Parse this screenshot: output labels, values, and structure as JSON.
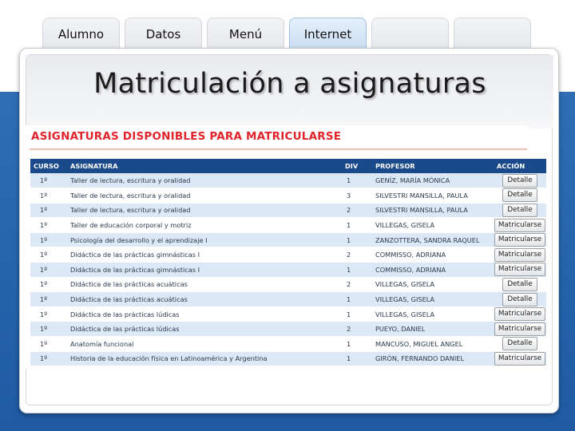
{
  "tabs": [
    {
      "label": "Alumno",
      "active": false
    },
    {
      "label": "Datos",
      "active": false
    },
    {
      "label": "Menú",
      "active": false
    },
    {
      "label": "Internet",
      "active": true
    },
    {
      "label": "",
      "active": false
    },
    {
      "label": "",
      "active": false
    }
  ],
  "page_title": "Matriculación a asignaturas",
  "section_title": "ASIGNATURAS DISPONIBLES PARA MATRICULARSE",
  "table": {
    "headers": {
      "curso": "CURSO",
      "asignatura": "ASIGNATURA",
      "div": "DIV",
      "profesor": "PROFESOR",
      "accion": "ACCIÓN"
    },
    "rows": [
      {
        "curso": "1º",
        "asignatura": "Taller de lectura, escritura y oralidad",
        "div": "1",
        "profesor": "GENÍZ, MARÍA MÓNICA",
        "accion": "Detalle"
      },
      {
        "curso": "1º",
        "asignatura": "Taller de lectura, escritura y oralidad",
        "div": "3",
        "profesor": "SILVESTRI MANSILLA, PAULA",
        "accion": "Detalle"
      },
      {
        "curso": "1º",
        "asignatura": "Taller de lectura, escritura y oralidad",
        "div": "2",
        "profesor": "SILVESTRI MANSILLA, PAULA",
        "accion": "Detalle"
      },
      {
        "curso": "1º",
        "asignatura": "Taller de educación corporal y motriz",
        "div": "1",
        "profesor": "VILLEGAS, GISELA",
        "accion": "Matricularse"
      },
      {
        "curso": "1º",
        "asignatura": "Psicología del desarrollo y el aprendizaje I",
        "div": "1",
        "profesor": "ZANZOTTERA, SANDRA RAQUEL",
        "accion": "Matricularse"
      },
      {
        "curso": "1º",
        "asignatura": "Didáctica de las prácticas gimnásticas I",
        "div": "2",
        "profesor": "COMMISSO, ADRIANA",
        "accion": "Matricularse"
      },
      {
        "curso": "1º",
        "asignatura": "Didáctica de las prácticas gimnásticas I",
        "div": "1",
        "profesor": "COMMISSO, ADRIANA",
        "accion": "Matricularse"
      },
      {
        "curso": "1º",
        "asignatura": "Didáctica de las prácticas acuáticas",
        "div": "2",
        "profesor": "VILLEGAS, GISELA",
        "accion": "Detalle"
      },
      {
        "curso": "1º",
        "asignatura": "Didáctica de las prácticas acuáticas",
        "div": "1",
        "profesor": "VILLEGAS, GISELA",
        "accion": "Detalle"
      },
      {
        "curso": "1º",
        "asignatura": "Didáctica de las prácticas lúdicas",
        "div": "1",
        "profesor": "VILLEGAS, GISELA",
        "accion": "Matricularse"
      },
      {
        "curso": "1º",
        "asignatura": "Didáctica de las prácticas lúdicas",
        "div": "2",
        "profesor": "PUEYO, DANIEL",
        "accion": "Matricularse"
      },
      {
        "curso": "1º",
        "asignatura": "Anatomía funcional",
        "div": "1",
        "profesor": "MANCUSO, MIGUEL ANGEL",
        "accion": "Detalle"
      },
      {
        "curso": "1º",
        "asignatura": "Historia de la educación física en Latinoamérica y Argentina",
        "div": "1",
        "profesor": "GIRÓN, FERNANDO DANIEL",
        "accion": "Matricularse"
      }
    ]
  },
  "colors": {
    "header_bg": "#1b4a8c",
    "row_alt_bg": "#dce8f5",
    "section_title": "#e0242c",
    "background_band": "#2f6db4"
  }
}
